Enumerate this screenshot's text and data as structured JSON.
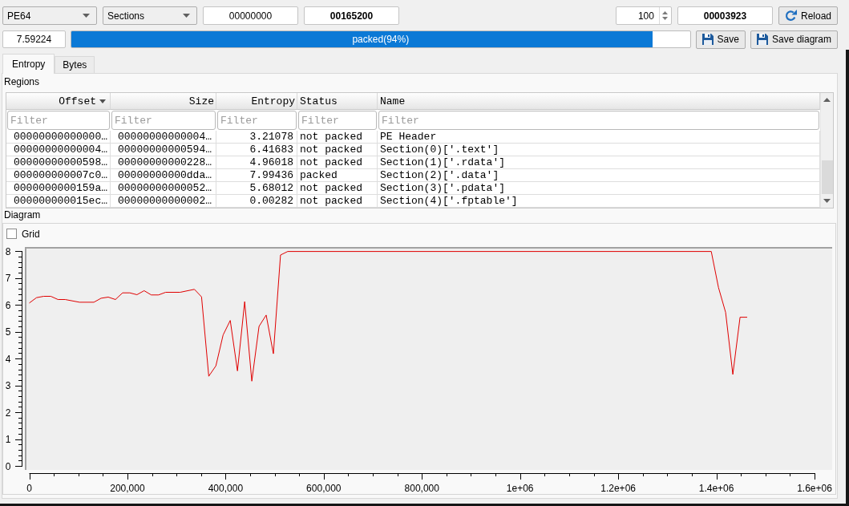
{
  "toolbar": {
    "combos": [
      "PE64",
      "Sections"
    ],
    "fields": [
      "00000000",
      "00165200"
    ],
    "spin_value": "100",
    "count_field": "00003923",
    "reload_button": "Reload"
  },
  "progress_row": {
    "value_field": "7.59224",
    "progress": {
      "label": "packed(94%)",
      "level": 0.94
    },
    "buttons": [
      "Save",
      "Save diagram"
    ]
  },
  "tabs": [
    {
      "label": "Entropy",
      "selected": true
    },
    {
      "label": "Bytes",
      "selected": false
    }
  ],
  "regions": {
    "title": "Regions",
    "columns": [
      {
        "label": "Offset",
        "kind": "hex",
        "sorted": true,
        "placeholder": "Filter"
      },
      {
        "label": "Size",
        "kind": "hex",
        "sorted": false,
        "placeholder": "Filter"
      },
      {
        "label": "Entropy",
        "kind": "number",
        "sorted": false,
        "placeholder": "Filter"
      },
      {
        "label": "Status",
        "kind": "text",
        "sorted": false,
        "placeholder": "Filter"
      },
      {
        "label": "Name",
        "kind": "text",
        "sorted": false,
        "placeholder": "Filter"
      }
    ],
    "rows": [
      [
        "00000000000000…",
        "00000000000004…",
        "3.21078",
        "not packed",
        "PE Header"
      ],
      [
        "00000000000004…",
        "00000000000594…",
        "6.41683",
        "not packed",
        "Section(0)['.text']"
      ],
      [
        "00000000000598…",
        "00000000000228…",
        "4.96018",
        "not packed",
        "Section(1)['.rdata']"
      ],
      [
        "000000000007c0…",
        "00000000000dda…",
        "7.99436",
        "packed",
        "Section(2)['.data']"
      ],
      [
        "0000000000159a…",
        "00000000000052…",
        "5.68012",
        "not packed",
        "Section(3)['.pdata']"
      ],
      [
        "000000000015ec…",
        "00000000000002…",
        "0.00282",
        "not packed",
        "Section(4)['.fptable']"
      ]
    ]
  },
  "diagram": {
    "title": "Diagram",
    "grid": {
      "label": "Grid",
      "checked": false
    },
    "chart_data": {
      "type": "line",
      "x": [
        0,
        14628,
        29256,
        43884,
        58512,
        73140,
        102396,
        131652,
        146280,
        160908,
        175536,
        190164,
        204792,
        219420,
        234048,
        248676,
        263304,
        277932,
        307188,
        336444,
        351072,
        365700,
        380328,
        394956,
        409584,
        424212,
        438840,
        453468,
        468096,
        482724,
        497352,
        511980,
        526608,
        1389660,
        1404288,
        1418916,
        1433544,
        1448172,
        1462800
      ],
      "series": [
        {
          "color": "#e00000",
          "values": [
            6.07,
            6.27,
            6.32,
            6.32,
            6.2,
            6.2,
            6.1,
            6.1,
            6.25,
            6.29,
            6.2,
            6.45,
            6.45,
            6.38,
            6.53,
            6.37,
            6.37,
            6.47,
            6.47,
            6.58,
            6.3,
            3.34,
            3.73,
            4.88,
            5.42,
            3.54,
            6.12,
            3.16,
            5.2,
            5.62,
            4.18,
            7.86,
            7.99,
            7.99,
            6.65,
            5.72,
            3.41,
            5.54,
            5.54
          ]
        }
      ],
      "xlim": [
        0,
        1600000
      ],
      "ylim": [
        0,
        8
      ],
      "xticks": [
        {
          "value": 0,
          "label": "0"
        },
        {
          "value": 200000,
          "label": "200,000"
        },
        {
          "value": 400000,
          "label": "400,000"
        },
        {
          "value": 600000,
          "label": "600,000"
        },
        {
          "value": 800000,
          "label": "800,000"
        },
        {
          "value": 1000000,
          "label": "1e+06"
        },
        {
          "value": 1200000,
          "label": "1.2e+06"
        },
        {
          "value": 1400000,
          "label": "1.4e+06"
        },
        {
          "value": 1600000,
          "label": "1.6e+06"
        }
      ],
      "yticks": [
        0,
        1,
        2,
        3,
        4,
        5,
        6,
        7,
        8
      ]
    }
  }
}
